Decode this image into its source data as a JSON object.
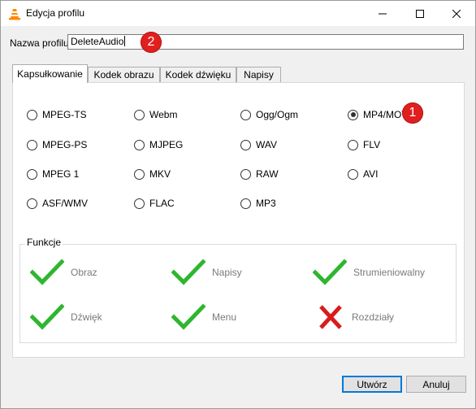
{
  "window": {
    "title": "Edycja profilu",
    "minimize_glyph": "—",
    "maximize_glyph": "☐",
    "close_glyph": "✕"
  },
  "profile": {
    "label": "Nazwa profilu",
    "value": "DeleteAudio"
  },
  "tabs": [
    {
      "label": "Kapsułkowanie",
      "active": true
    },
    {
      "label": "Kodek obrazu",
      "active": false
    },
    {
      "label": "Kodek dźwięku",
      "active": false
    },
    {
      "label": "Napisy",
      "active": false
    }
  ],
  "formats": [
    {
      "label": "MPEG-TS",
      "checked": false
    },
    {
      "label": "Webm",
      "checked": false
    },
    {
      "label": "Ogg/Ogm",
      "checked": false
    },
    {
      "label": "MP4/MOV",
      "checked": true
    },
    {
      "label": "MPEG-PS",
      "checked": false
    },
    {
      "label": "MJPEG",
      "checked": false
    },
    {
      "label": "WAV",
      "checked": false
    },
    {
      "label": "FLV",
      "checked": false
    },
    {
      "label": "MPEG 1",
      "checked": false
    },
    {
      "label": "MKV",
      "checked": false
    },
    {
      "label": "RAW",
      "checked": false
    },
    {
      "label": "AVI",
      "checked": false
    },
    {
      "label": "ASF/WMV",
      "checked": false
    },
    {
      "label": "FLAC",
      "checked": false
    },
    {
      "label": "MP3",
      "checked": false
    }
  ],
  "features": {
    "title": "Funkcje",
    "items": [
      {
        "label": "Obraz",
        "supported": true
      },
      {
        "label": "Napisy",
        "supported": true
      },
      {
        "label": "Strumieniowalny",
        "supported": true
      },
      {
        "label": "Dźwięk",
        "supported": true
      },
      {
        "label": "Menu",
        "supported": true
      },
      {
        "label": "Rozdziały",
        "supported": false
      }
    ]
  },
  "annotations": [
    "1",
    "2"
  ],
  "buttons": {
    "create": "Utwórz",
    "cancel": "Anuluj"
  },
  "colors": {
    "check": "#2fb62f",
    "cross": "#d81c1c",
    "badge": "#e01f1f",
    "vlc_orange": "#ff8800"
  }
}
